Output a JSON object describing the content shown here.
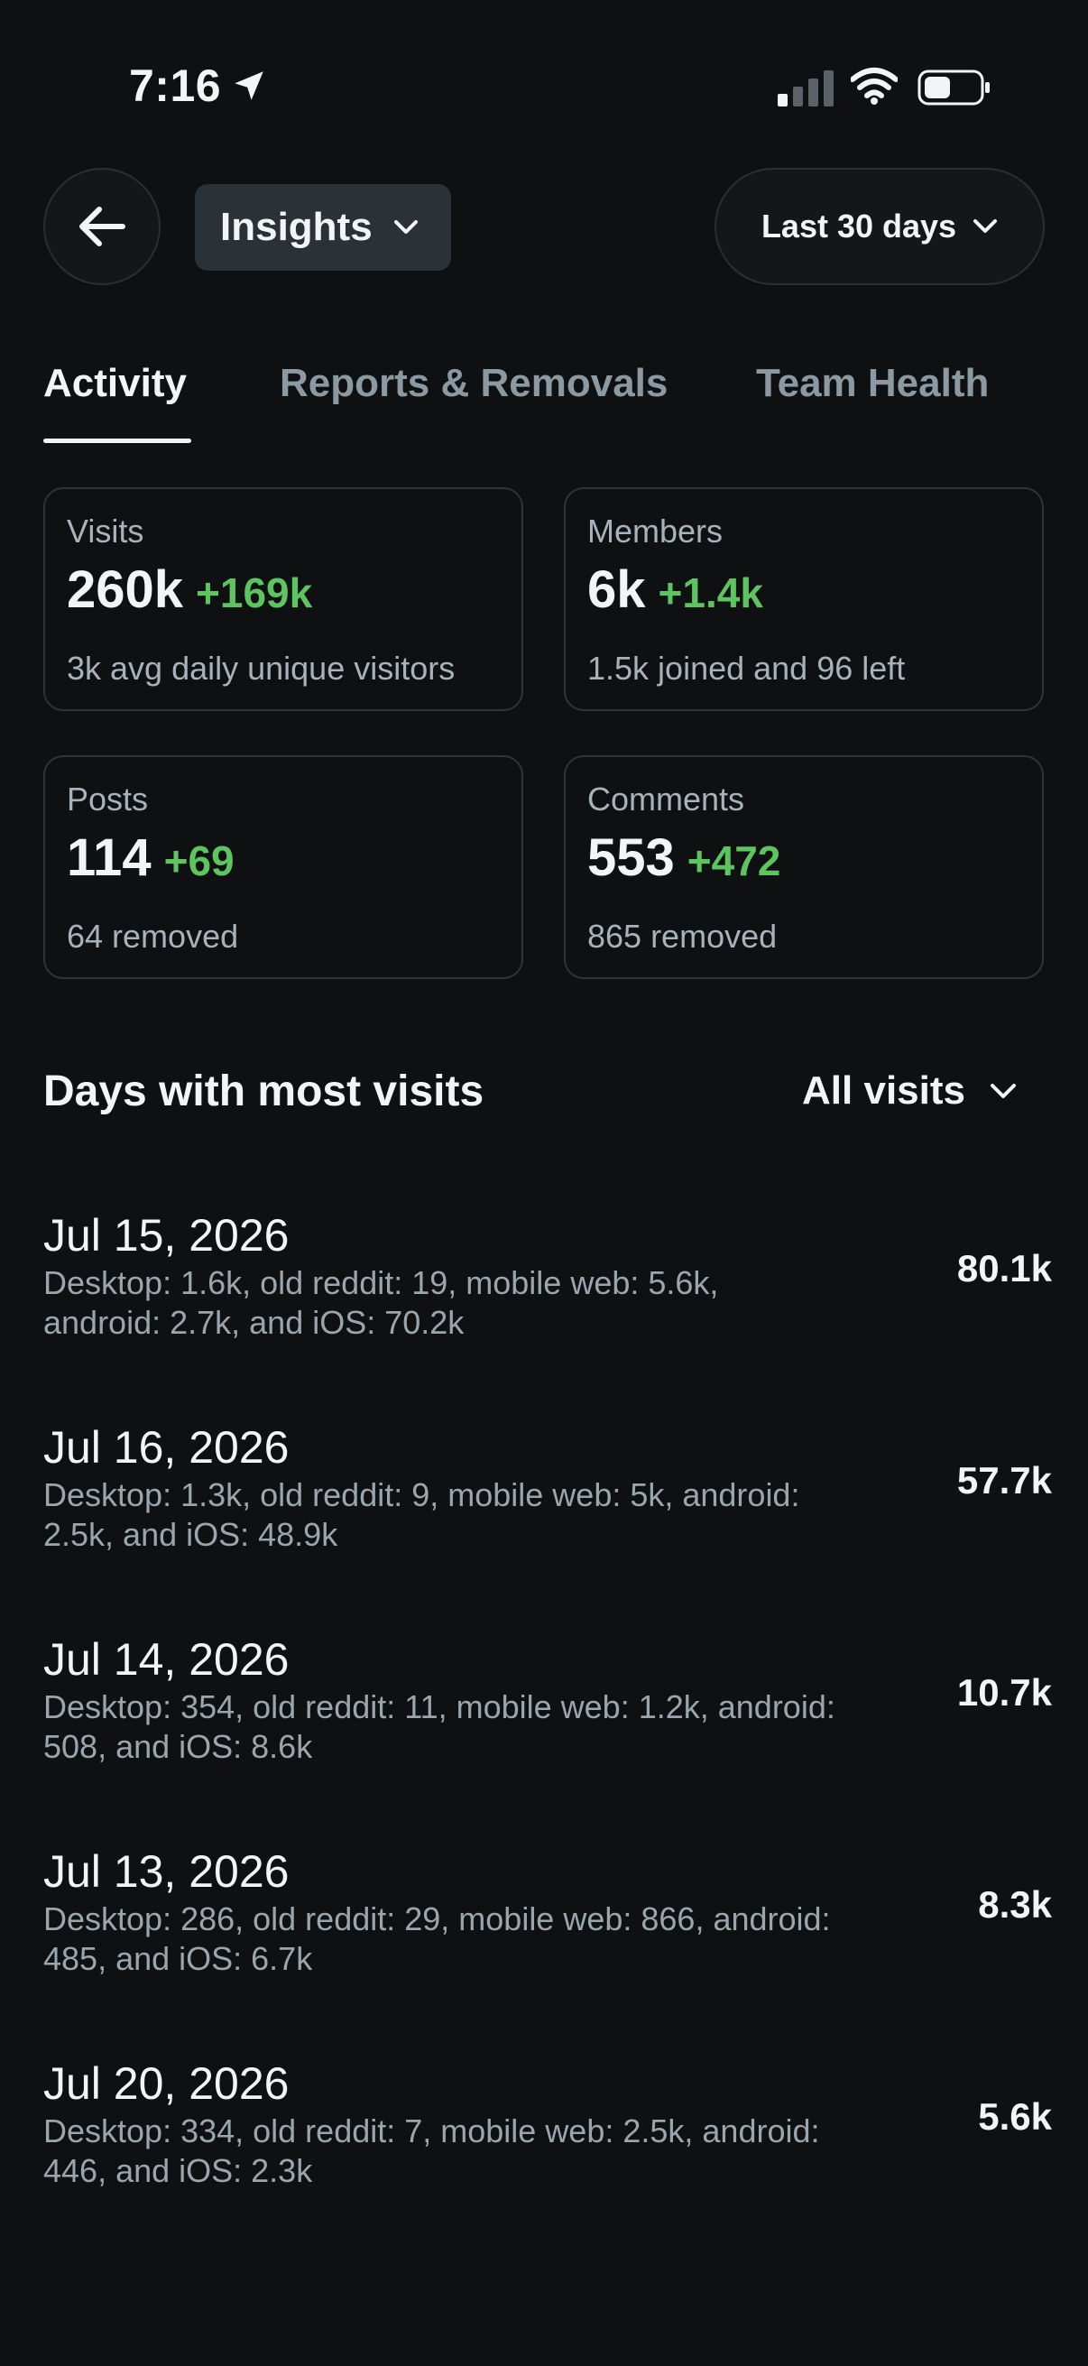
{
  "status": {
    "time": "7:16"
  },
  "header": {
    "title": "Insights",
    "range": "Last 30 days"
  },
  "tabs": [
    {
      "label": "Activity"
    },
    {
      "label": "Reports & Removals"
    },
    {
      "label": "Team Health"
    }
  ],
  "stats": [
    {
      "label": "Visits",
      "value": "260k",
      "delta": "+169k",
      "sub": "3k avg daily unique visitors"
    },
    {
      "label": "Members",
      "value": "6k",
      "delta": "+1.4k",
      "sub": "1.5k joined and 96 left"
    },
    {
      "label": "Posts",
      "value": "114",
      "delta": "+69",
      "sub": "64 removed"
    },
    {
      "label": "Comments",
      "value": "553",
      "delta": "+472",
      "sub": "865 removed"
    }
  ],
  "section": {
    "title": "Days with most visits",
    "filter": "All visits"
  },
  "days": [
    {
      "date": "Jul 15, 2026",
      "detail": "Desktop: 1.6k, old reddit: 19, mobile web: 5.6k, android: 2.7k, and iOS: 70.2k",
      "value": "80.1k"
    },
    {
      "date": "Jul 16, 2026",
      "detail": "Desktop: 1.3k, old reddit: 9, mobile web: 5k, android: 2.5k, and iOS: 48.9k",
      "value": "57.7k"
    },
    {
      "date": "Jul 14, 2026",
      "detail": "Desktop: 354, old reddit: 11, mobile web: 1.2k, android: 508, and iOS: 8.6k",
      "value": "10.7k"
    },
    {
      "date": "Jul 13, 2026",
      "detail": "Desktop: 286, old reddit: 29, mobile web: 866, android: 485, and iOS: 6.7k",
      "value": "8.3k"
    },
    {
      "date": "Jul 20, 2026",
      "detail": "Desktop: 334, old reddit: 7, mobile web: 2.5k, android: 446, and iOS: 2.3k",
      "value": "5.6k"
    }
  ],
  "colors": {
    "background": "#0e1012",
    "positive": "#5dc45f",
    "muted": "#9aa6ae",
    "card_border": "#2e3439"
  }
}
